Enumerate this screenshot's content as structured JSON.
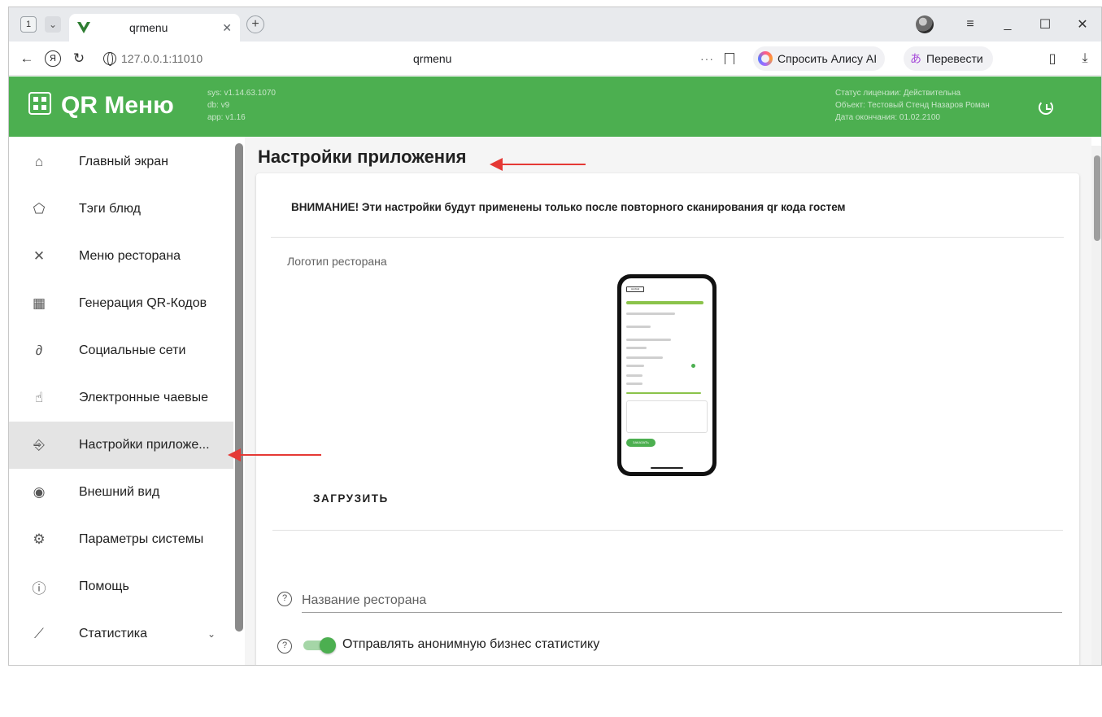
{
  "browser": {
    "tab_count": "1",
    "tab_title": "qrmenu",
    "url_host": "127.0.0.1:11010",
    "url_page_title": "qrmenu",
    "alice_label": "Спросить Алису AI",
    "translate_label": "Перевести",
    "icons": [
      "back-arrow-icon",
      "yandex-icon",
      "reload-icon",
      "globe-icon",
      "bookmark-icon",
      "sidebar-icon",
      "download-icon"
    ]
  },
  "header": {
    "app_name": "QR Меню",
    "version_sys": "sys: v1.14.63.1070",
    "version_db": "db: v9",
    "version_app": "app: v1.16",
    "license_status": "Статус лицензии: Действительна",
    "license_object": "Объект: Тестовый Стенд Назаров Роман",
    "license_expiry": "Дата окончания: 01.02.2100",
    "brand_color": "#4caf50"
  },
  "sidebar": {
    "items": [
      {
        "label": "Главный экран",
        "icon": "home-icon"
      },
      {
        "label": "Тэги блюд",
        "icon": "tag-icon"
      },
      {
        "label": "Меню ресторана",
        "icon": "utensils-icon"
      },
      {
        "label": "Генерация QR-Кодов",
        "icon": "qr-code-icon"
      },
      {
        "label": "Социальные сети",
        "icon": "link-icon"
      },
      {
        "label": "Электронные чаевые",
        "icon": "tip-hand-icon"
      },
      {
        "label": "Настройки приложе...",
        "icon": "app-settings-icon",
        "active": true
      },
      {
        "label": "Внешний вид",
        "icon": "eye-icon"
      },
      {
        "label": "Параметры системы",
        "icon": "gear-icon"
      },
      {
        "label": "Помощь",
        "icon": "help-icon"
      },
      {
        "label": "Статистика",
        "icon": "chart-icon",
        "expandable": true
      }
    ]
  },
  "main": {
    "page_title": "Настройки приложения",
    "warning": "ВНИМАНИЕ! Эти настройки будут применены только после повторного сканирования qr кода гостем",
    "logo_label": "Логотип ресторана",
    "upload_label": "ЗАГРУЗИТЬ",
    "restaurant_name_placeholder": "Название ресторана",
    "stats_toggle_label": "Отправлять анонимную бизнес статистику",
    "stats_toggle_on": true,
    "phone_preview": {
      "back_label": "НАЗАД",
      "order_button": "ЗАКАЗАТЬ"
    }
  },
  "annotation_color": "#e53935"
}
